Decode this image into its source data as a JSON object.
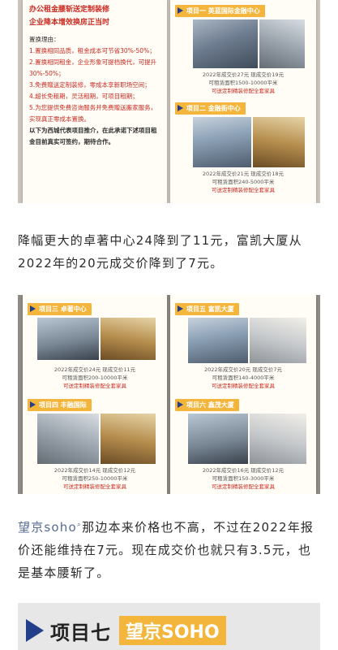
{
  "photo1": {
    "left_flyer": {
      "headline": [
        "办公租金腰斩送定制装修",
        "企业降本增效换房正当时"
      ],
      "reasons_title": "置换理由：",
      "reasons": [
        "1.置换相同品质，租金成本可节省30%-50%；",
        "2.置换相同租金，企业形象可提档换代，可提升30%-50%；",
        "3.免费赠送定制装修，零成本享新职场空间；",
        "4.超长免租期，灵活租期，可项目租期；",
        "5.为您提供免费咨询服务并免费赠送搬家服务，实现真正零成本置换。"
      ],
      "footer": "以下为西城代表项目推介，在此承诺下述项目租金目前真实可签约，期待合作。"
    },
    "right_flyer": {
      "project1": {
        "tag": "项目一 英蓝国际金融中心",
        "price": "2022年成交价27元 现成交价19元",
        "area": "可租赁面积1500-10000平米",
        "note": "可送定制精装修配全套家具"
      },
      "project2": {
        "tag": "项目二 金融街中心",
        "price": "2022年成交价21元 现成交价18元",
        "area": "可租赁面积240-5000平米",
        "note": "可送定制精装修配全套家具"
      }
    }
  },
  "paragraph1": "降幅更大的卓著中心24降到了11元，富凯大厦从2022年的20元成交价降到了7元。",
  "photo2": {
    "project3": {
      "tag": "项目三 卓著中心",
      "price": "2022年成交价24元 现成交价11元",
      "area": "可租赁面积200-10000平米",
      "note": "可送定制精装修配全套家具"
    },
    "project4": {
      "tag": "项目四 丰融国际",
      "price": "2022年成交价14元 现成交价12元",
      "area": "可租赁面积250-10000平米",
      "note": "可送定制精装修配全套家具"
    },
    "project5": {
      "tag": "项目五 富凯大厦",
      "price": "2022年成交价20元 现成交价7元",
      "area": "可租赁面积140-4000平米",
      "note": "可送定制精装修配全套家具"
    },
    "project6": {
      "tag": "项目六 鑫茂大厦",
      "price": "2022年成交价16元 现成交价12元",
      "area": "可租赁面积150-3000平米",
      "note": "可送定制精装修配全套家具"
    }
  },
  "paragraph2": {
    "link": "望京soho",
    "rest": "那边本来价格也不高，不过在2022年报价还能维持在7元。现在成交价也就只有3.5元，也是基本腰斩了。"
  },
  "photo3": {
    "label": "项目七",
    "name": "望京SOHO"
  },
  "colors": {
    "accent_red": "#c92a20",
    "tag_gold": "#f3b53c",
    "tag_arrow_blue": "#233f8c",
    "link_blue": "#576b95"
  }
}
